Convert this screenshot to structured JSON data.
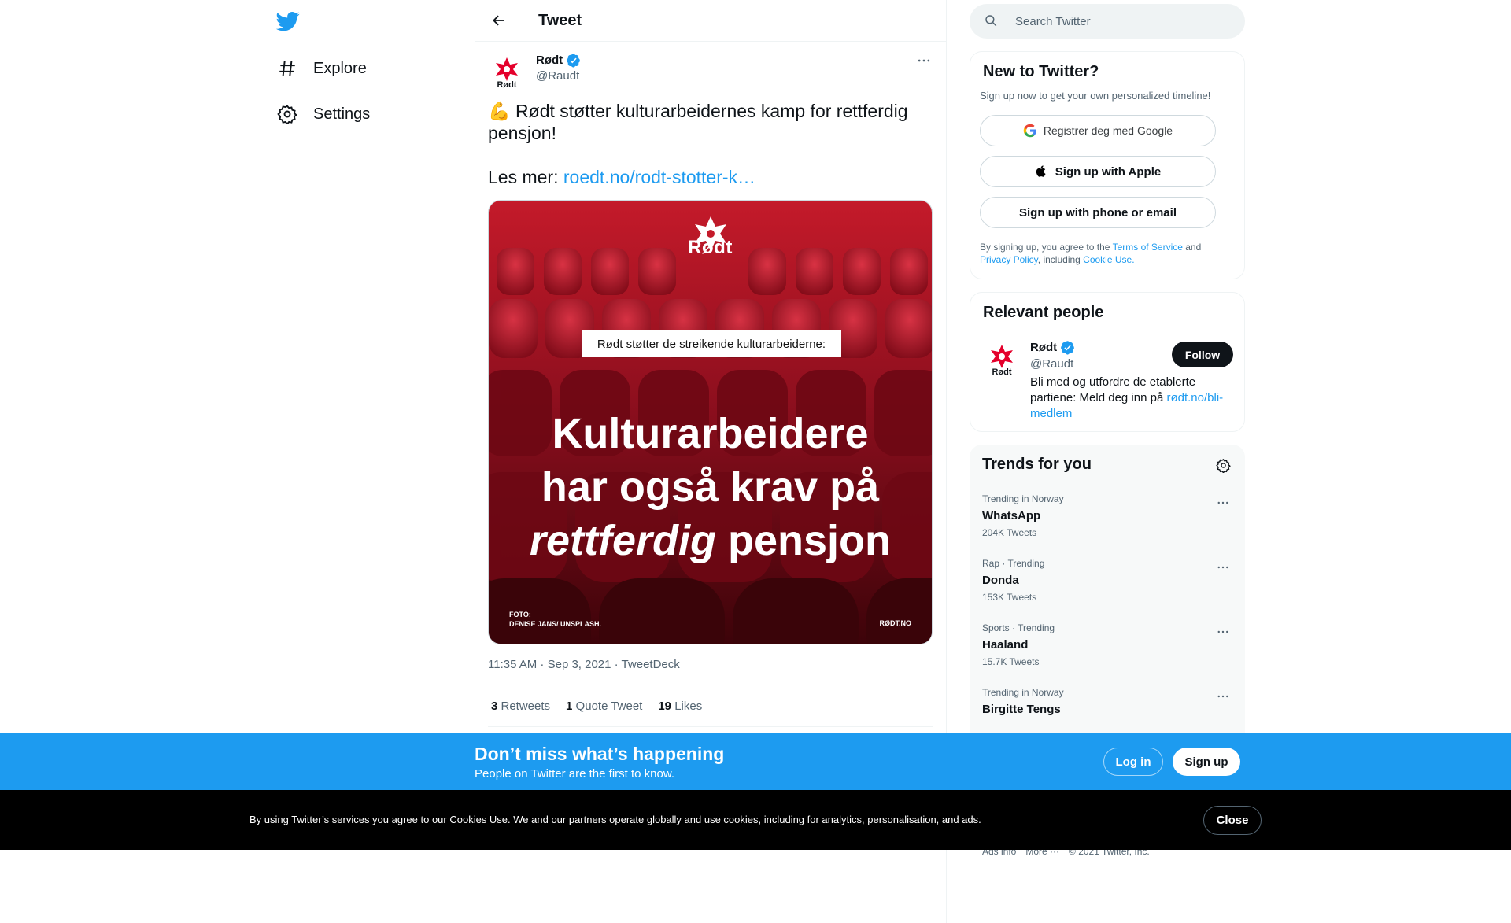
{
  "nav": {
    "items": [
      {
        "label": "Explore",
        "icon": "hashtag-icon"
      },
      {
        "label": "Settings",
        "icon": "gear-icon"
      }
    ]
  },
  "header": {
    "title": "Tweet"
  },
  "tweet": {
    "author": {
      "name": "Rødt",
      "handle": "@Raudt",
      "verified": true
    },
    "text_line1": "Rødt støtter kulturarbeidernes kamp for rettferdig pensjon!",
    "emoji": "💪",
    "text_more_prefix": "Les mer: ",
    "link_text": "roedt.no/rodt-stotter-k…",
    "media": {
      "brand": "Rødt",
      "banner": "Rødt støtter de streikende kulturarbeiderne:",
      "headline_line1": "Kulturarbeidere",
      "headline_line2": "har også krav på",
      "headline_italic": "rettferdig",
      "headline_rest": " pensjon",
      "credit_line1": "FOTO:",
      "credit_line2": "DENISE JANS/ UNSPLASH.",
      "site": "RØDT.NO"
    },
    "meta": "11:35 AM · Sep 3, 2021 · TweetDeck",
    "stats": {
      "retweets_count": "3",
      "retweets_label": " Retweets",
      "quotes_count": "1",
      "quotes_label": " Quote Tweet",
      "likes_count": "19",
      "likes_label": " Likes"
    }
  },
  "search": {
    "placeholder": "Search Twitter"
  },
  "new_to_twitter": {
    "title": "New to Twitter?",
    "subtitle": "Sign up now to get your own personalized timeline!",
    "google_label": "Registrer deg med Google",
    "apple_label": "Sign up with Apple",
    "phone_label": "Sign up with phone or email",
    "legal_prefix": "By signing up, you agree to the ",
    "terms": "Terms of Service",
    "and": " and",
    "privacy": "Privacy Policy",
    "including": ", including ",
    "cookie": "Cookie Use."
  },
  "relevant_people": {
    "title": "Relevant people",
    "name": "Rødt",
    "handle": "@Raudt",
    "bio": "Bli med og utfordre de etablerte partiene: Meld deg inn på ",
    "bio_link": "rødt.no/bli-medlem",
    "follow_label": "Follow"
  },
  "trends": {
    "title": "Trends for you",
    "items": [
      {
        "context": "Trending in Norway",
        "name": "WhatsApp",
        "count": "204K Tweets"
      },
      {
        "context": "Rap · Trending",
        "name": "Donda",
        "count": "153K Tweets"
      },
      {
        "context": "Sports · Trending",
        "name": "Haaland",
        "count": "15.7K Tweets"
      },
      {
        "context": "Trending in Norway",
        "name": "Birgitte Tengs",
        "count": ""
      }
    ]
  },
  "footer": {
    "ads_info": "Ads info",
    "more": "More ···",
    "copyright": "© 2021 Twitter, Inc."
  },
  "signup_bar": {
    "title": "Don’t miss what’s happening",
    "subtitle": "People on Twitter are the first to know.",
    "login_label": "Log in",
    "signup_label": "Sign up"
  },
  "cookie_bar": {
    "text": "By using Twitter’s services you agree to our Cookies Use. We and our partners operate globally and use cookies, including for analytics, personalisation, and ads.",
    "close_label": "Close"
  },
  "colors": {
    "accent": "#1d9bf0",
    "brand_red": "#e4002b",
    "text": "#0f1419",
    "muted": "#536471"
  }
}
